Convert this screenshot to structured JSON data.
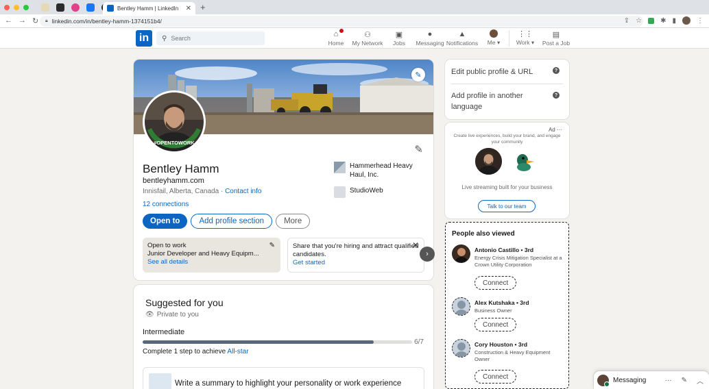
{
  "browser": {
    "tab_title": "Bentley Hamm | LinkedIn",
    "tab_close": "✕",
    "new_tab": "+",
    "url": "linkedin.com/in/bentley-hamm-1374151b4/"
  },
  "nav": {
    "logo": "in",
    "search_placeholder": "Search",
    "items": [
      {
        "label": "Home"
      },
      {
        "label": "My Network"
      },
      {
        "label": "Jobs"
      },
      {
        "label": "Messaging"
      },
      {
        "label": "Notifications"
      },
      {
        "label": "Me"
      },
      {
        "label": "Work"
      },
      {
        "label": "Post a Job"
      }
    ]
  },
  "profile": {
    "name": "Bentley Hamm",
    "website": "bentleyhamm.com",
    "location": "Innisfail, Alberta, Canada",
    "location_sep": " · ",
    "contact_info": "Contact info",
    "connections": "12 connections",
    "open_to_work_frame": "#OPENTOWORK",
    "companies": [
      {
        "name": "Hammerhead Heavy Haul, Inc."
      },
      {
        "name": "StudioWeb"
      }
    ],
    "buttons": {
      "open_to": "Open to",
      "add_section": "Add profile section",
      "more": "More"
    },
    "open_to_work": {
      "title": "Open to work",
      "roles": "Junior Developer and Heavy Equipm...",
      "link": "See all details"
    },
    "hiring": {
      "text_bold": "Share that you're hiring",
      "text_rest": " and attract qualified candidates.",
      "link": "Get started"
    }
  },
  "suggested": {
    "title": "Suggested for you",
    "privacy": "Private to you",
    "level": "Intermediate",
    "progress": 0.857,
    "progress_text": "6/7",
    "step_text": "Complete 1 step to achieve ",
    "step_link": "All-star",
    "summary_prompt": "Write a summary to highlight your personality or work experience"
  },
  "rail": {
    "edit_public": "Edit public profile & URL",
    "another_language": "Add profile in another language",
    "help_glyph": "?",
    "ad": {
      "label": "Ad",
      "more": "···",
      "text": "Create live experiences, build your brand, and engage your community",
      "tagline": "Live streaming built for your business",
      "cta": "Talk to our team"
    },
    "people_also_viewed": {
      "title": "People also viewed",
      "people": [
        {
          "name": "Antonio Castillo • 3rd",
          "desc": "Energy Crisis Mitigation Specialist at a Crown Utility Corporation",
          "button": "Connect"
        },
        {
          "name": "Alex Kutshaka • 3rd",
          "desc": "Business Owner",
          "button": "Connect"
        },
        {
          "name": "Cory Houston • 3rd",
          "desc": "Construction & Heavy Equipment Owner",
          "button": "Connect"
        }
      ]
    }
  },
  "messaging": {
    "label": "Messaging"
  },
  "colors": {
    "brand": "#0a66c2",
    "page_bg": "#f3f2ef",
    "open_to_work_green": "#2e7d32"
  }
}
